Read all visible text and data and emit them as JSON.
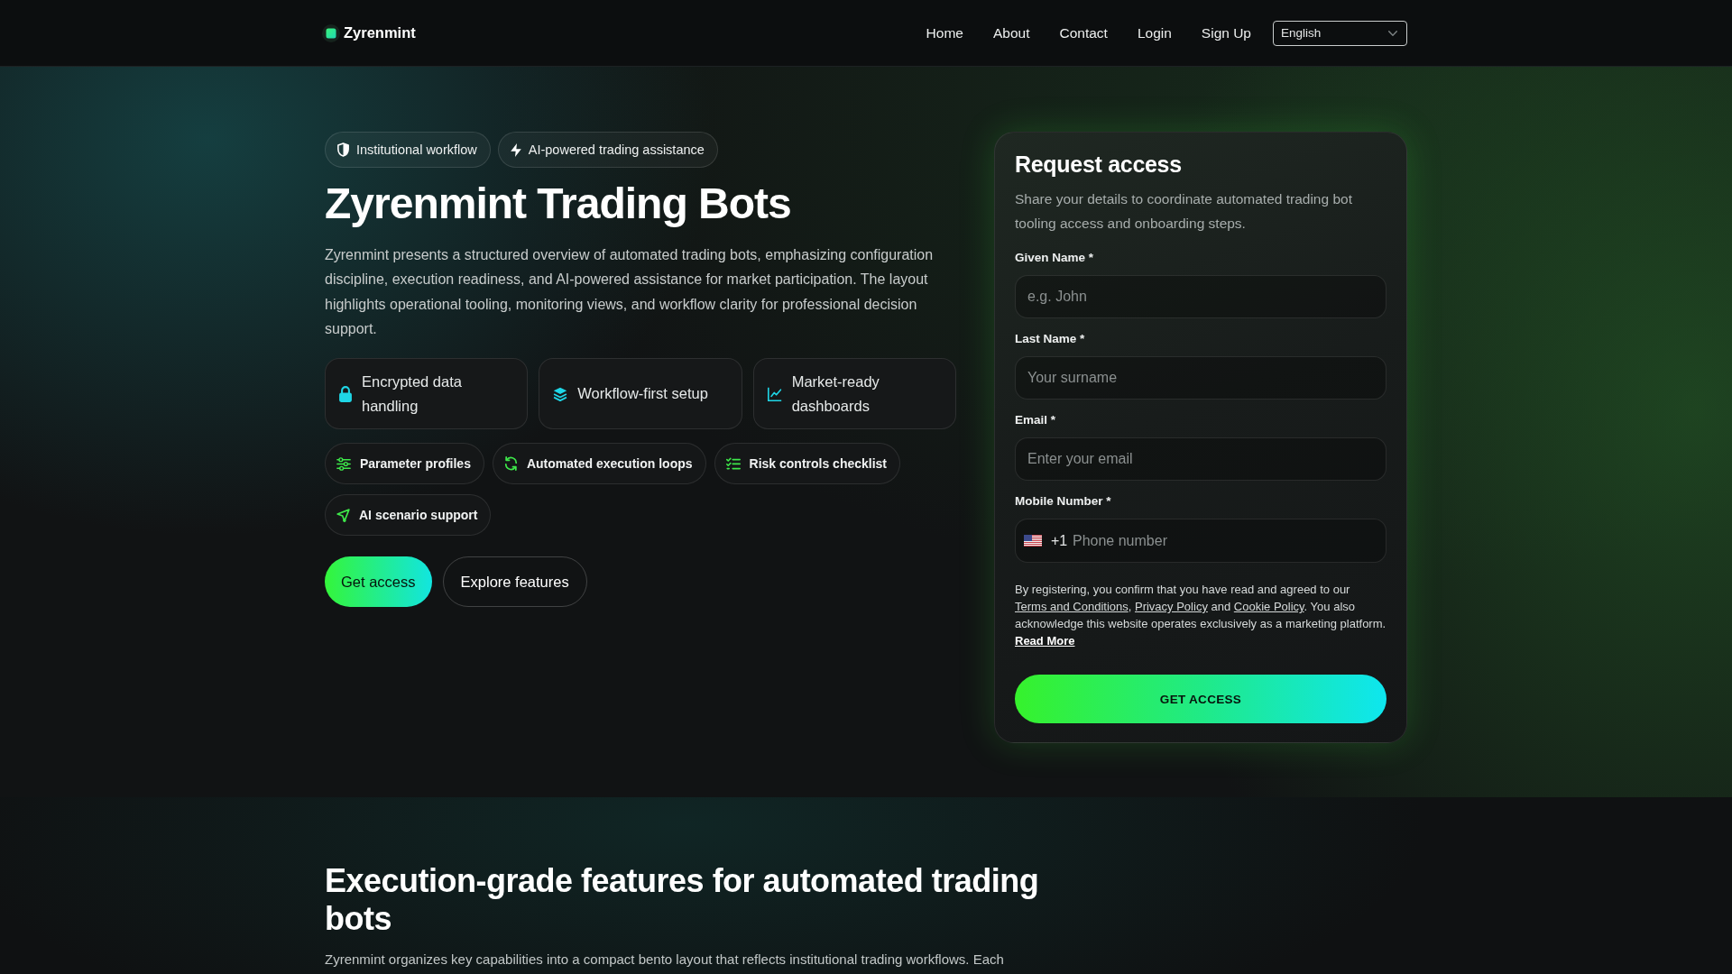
{
  "header": {
    "brand": "Zyrenmint",
    "nav": [
      "Home",
      "About",
      "Contact",
      "Login",
      "Sign Up"
    ],
    "language": "English"
  },
  "hero": {
    "badges": [
      "Institutional workflow",
      "AI-powered trading assistance"
    ],
    "title": "Zyrenmint Trading Bots",
    "description": "Zyrenmint presents a structured overview of automated trading bots, emphasizing configuration discipline, execution readiness, and AI-powered assistance for market participation. The layout highlights operational tooling, monitoring views, and workflow clarity for professional decision support.",
    "feature_cards": [
      "Encrypted data handling",
      "Workflow-first setup",
      "Market-ready dashboards"
    ],
    "chips": [
      "Parameter profiles",
      "Automated execution loops",
      "Risk controls checklist",
      "AI scenario support"
    ],
    "actions": [
      {
        "kind": "primary",
        "label": "Get access"
      },
      {
        "kind": "secondary",
        "label": "Explore features"
      }
    ]
  },
  "form": {
    "title": "Request access",
    "subtitle": "Share your details to coordinate automated trading bot tooling access and onboarding steps.",
    "fields": [
      {
        "kind": "text",
        "label": "Given Name *",
        "placeholder": "e.g. John"
      },
      {
        "kind": "text",
        "label": "Last Name *",
        "placeholder": "Your surname"
      },
      {
        "kind": "email",
        "label": "Email *",
        "placeholder": "Enter your email"
      },
      {
        "kind": "phone",
        "label": "Mobile Number *",
        "dial_code": "+1",
        "placeholder": "Phone number"
      }
    ],
    "consent": [
      {
        "kind": "text",
        "text": "By registering, you confirm that you have read and agreed to our "
      },
      {
        "kind": "link",
        "text": "Terms and Conditions"
      },
      {
        "kind": "text",
        "text": ", "
      },
      {
        "kind": "link",
        "text": "Privacy Policy"
      },
      {
        "kind": "text",
        "text": " and "
      },
      {
        "kind": "link",
        "text": "Cookie Policy"
      },
      {
        "kind": "text",
        "text": ". You also acknowledge this website operates exclusively as a marketing platform. "
      },
      {
        "kind": "more",
        "text": "Read More"
      }
    ],
    "submit": "GET ACCESS"
  },
  "features_section": {
    "title": "Execution-grade features for automated trading bots",
    "intro": "Zyrenmint organizes key capabilities into a compact bento layout that reflects institutional trading workflows. Each"
  }
}
